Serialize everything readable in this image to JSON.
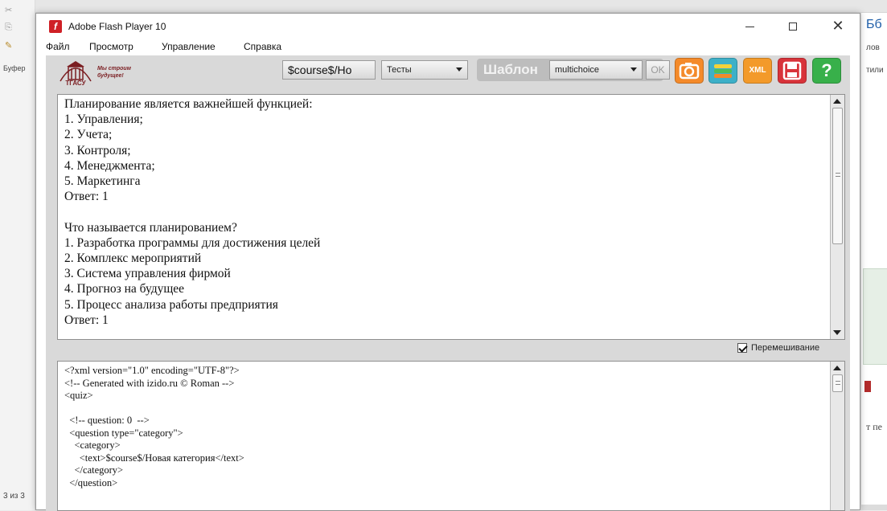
{
  "background": {
    "left_panel": {
      "clipboard_label": "Буфер",
      "page_count": "3 из 3"
    },
    "right_panel": {
      "text1": "Бб",
      "text2": "лов",
      "text3": "тили",
      "text4": "т пе"
    }
  },
  "window": {
    "title": "Adobe Flash Player 10",
    "controls": {
      "minimize": "—",
      "maximize": "□",
      "close": "✕"
    }
  },
  "menu": {
    "items": [
      "Файл",
      "Просмотр",
      "Управление",
      "Справка"
    ]
  },
  "toolbar": {
    "logo_text": "Мы строим будущее!",
    "logo_caption": "ТГАСУ",
    "course_field": "$course$/Ho",
    "tests_select": "Тесты",
    "template_label": "Шаблон",
    "template_select": "multichoice",
    "ok_label": "OK",
    "xml_label": "XML",
    "help_label": "?"
  },
  "questions_text": "Планирование является важнейшей функцией:\n1. Управления;\n2. Учета;\n3. Контроля;\n4. Менеджмента;\n5. Маркетинга\nОтвет: 1\n\nЧто называется планированием?\n1. Разработка программы для достижения целей\n2. Комплекс мероприятий\n3. Система управления фирмой\n4. Прогноз на будущее\n5. Процесс анализа работы предприятия\nОтвет: 1",
  "shuffle": {
    "label": "Перемешивание",
    "checked": true
  },
  "xml_text": "<?xml version=\"1.0\" encoding=\"UTF-8\"?>\n<!-- Generated with izido.ru © Roman -->\n<quiz>\n\n  <!-- question: 0  -->\n  <question type=\"category\">\n    <category>\n      <text>$course$/Новая категория</text>\n    </category>\n  </question>"
}
